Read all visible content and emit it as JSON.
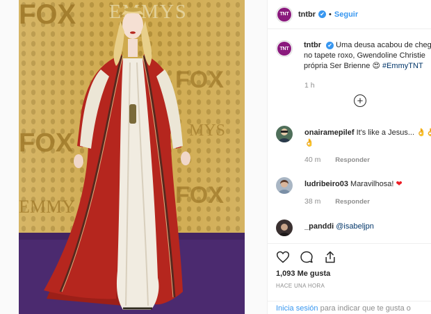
{
  "post": {
    "username": "tntbr",
    "verified_mark": "✔",
    "separator": "•",
    "follow_label": "Seguir"
  },
  "caption": {
    "username": "tntbr",
    "lines": [
      "Uma deusa acabou de chega",
      "no tapete roxo, Gwendoline Christie",
      "própria Ser Brienne 😍 "
    ],
    "hashtag": "#EmmyTNT",
    "time": "1 h"
  },
  "load_more_icon": "plus-circle-icon",
  "comments": [
    {
      "username": "onairamepilef",
      "text": "It's like a Jesus... 👌👌",
      "text2": "👌",
      "time": "40 m",
      "reply": "Responder"
    },
    {
      "username": "ludribeiro03",
      "text": "Maravilhosa! ",
      "emoji": "❤",
      "time": "38 m",
      "reply": "Responder"
    },
    {
      "username": "_panddi",
      "mention": "@isabeljpn"
    }
  ],
  "actions": {
    "icons": [
      "heart-icon",
      "comment-icon",
      "share-icon"
    ],
    "likes": "1,093 Me gusta",
    "posted": "HACE UNA HORA",
    "login_link": "Inicia sesión",
    "login_text": " para indicar que te gusta o"
  },
  "photo": {
    "backdrop_text_top": "FOX",
    "backdrop_text_emmys": "EMMYS",
    "backdrop_text_fox": "FOX",
    "backdrop_text_emmy": "EMMY",
    "colors": {
      "backdrop": "#c9a44a",
      "carpet": "#4b2a6f",
      "robe_red": "#b5261e",
      "gown_white": "#f1ece1"
    }
  },
  "colors": {
    "accent_blue": "#3897f0",
    "tnt_purple": "#8a1a7d",
    "muted": "#8e8e8e"
  }
}
